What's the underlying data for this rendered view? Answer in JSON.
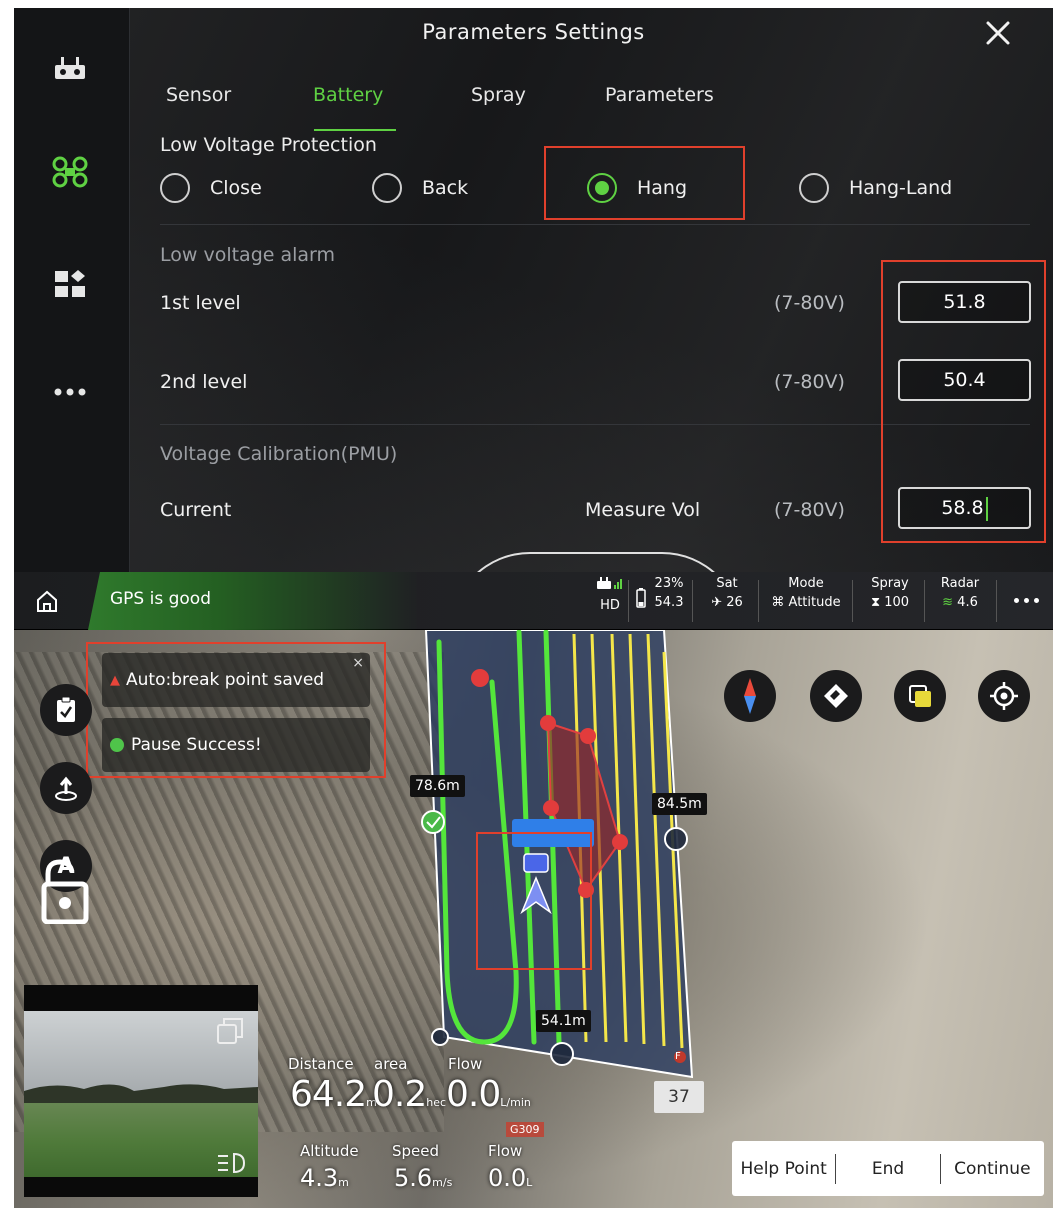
{
  "params": {
    "title": "Parameters Settings",
    "tabs": [
      {
        "label": "Sensor",
        "active": false
      },
      {
        "label": "Battery",
        "active": true
      },
      {
        "label": "Spray",
        "active": false
      },
      {
        "label": "Parameters",
        "active": false
      }
    ],
    "low_voltage_protection": {
      "heading": "Low Voltage Protection",
      "options": [
        "Close",
        "Back",
        "Hang",
        "Hang-Land"
      ],
      "selected": "Hang"
    },
    "alarm": {
      "heading": "Low voltage alarm",
      "level1_label": "1st level",
      "level1_range": "(7-80V)",
      "level1_value": "51.8",
      "level2_label": "2nd level",
      "level2_range": "(7-80V)",
      "level2_value": "50.4"
    },
    "calibration": {
      "heading": "Voltage Calibration(PMU)",
      "current_label": "Current",
      "measure_label": "Measure Vol",
      "range": "(7-80V)",
      "value": "58.8"
    },
    "accent_color": "#5fd143",
    "highlight_color": "#e0402c"
  },
  "flight": {
    "gps_status": "GPS is good",
    "status": {
      "link_label": "HD",
      "battery_percent": "23%",
      "battery_voltage": "54.3",
      "sat_label": "Sat",
      "sat_value": "26",
      "mode_label": "Mode",
      "mode_value": "Attitude",
      "spray_label": "Spray",
      "spray_value": "100",
      "radar_label": "Radar",
      "radar_value": "4.6"
    },
    "notifications": [
      {
        "text": "Auto:break point saved",
        "type": "warning"
      },
      {
        "text": "Pause Success!",
        "type": "success"
      }
    ],
    "map_labels": {
      "d1": "78.6m",
      "d2": "84.5m",
      "d3": "54.1m",
      "marker": "37",
      "point_f": "F",
      "road": "G309"
    },
    "telemetry": {
      "distance_label": "Distance",
      "distance_value": "64.2",
      "distance_unit": "m",
      "area_label": "area",
      "area_value": "0.2",
      "area_unit": "hec",
      "flow_label": "Flow",
      "flow_value": "0.0",
      "flow_unit": "L/min",
      "altitude_label": "Altitude",
      "altitude_value": "4.3",
      "altitude_unit": "m",
      "speed_label": "Speed",
      "speed_value": "5.6",
      "speed_unit": "m/s",
      "flow2_label": "Flow",
      "flow2_value": "0.0",
      "flow2_unit": "L"
    },
    "actions": {
      "help_point": "Help Point",
      "end": "End",
      "continue": "Continue"
    },
    "icons": [
      "home-icon",
      "checklist-icon",
      "return-icon",
      "lock-icon",
      "compass-icon",
      "eraser-icon",
      "layers-icon",
      "locate-icon"
    ]
  }
}
